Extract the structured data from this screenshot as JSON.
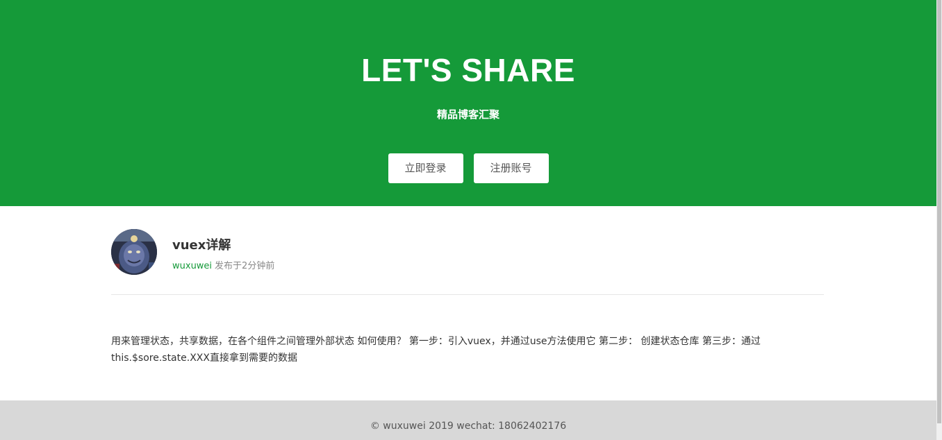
{
  "hero": {
    "title": "LET'S SHARE",
    "subtitle": "精品博客汇聚",
    "login_label": "立即登录",
    "register_label": "注册账号"
  },
  "article": {
    "title": "vuex详解",
    "author": "wuxuwei",
    "posted": "发布于2分钟前",
    "body": "用来管理状态，共享数据，在各个组件之间管理外部状态 如何使用？ 第一步：引入vuex，并通过use方法使用它 第二步： 创建状态仓库 第三步：通过this.$sore.state.XXX直接拿到需要的数据"
  },
  "footer": {
    "text": "© wuxuwei 2019 wechat: 18062402176"
  },
  "colors": {
    "brand_green": "#159a39",
    "footer_bg": "#d8d8d8"
  }
}
